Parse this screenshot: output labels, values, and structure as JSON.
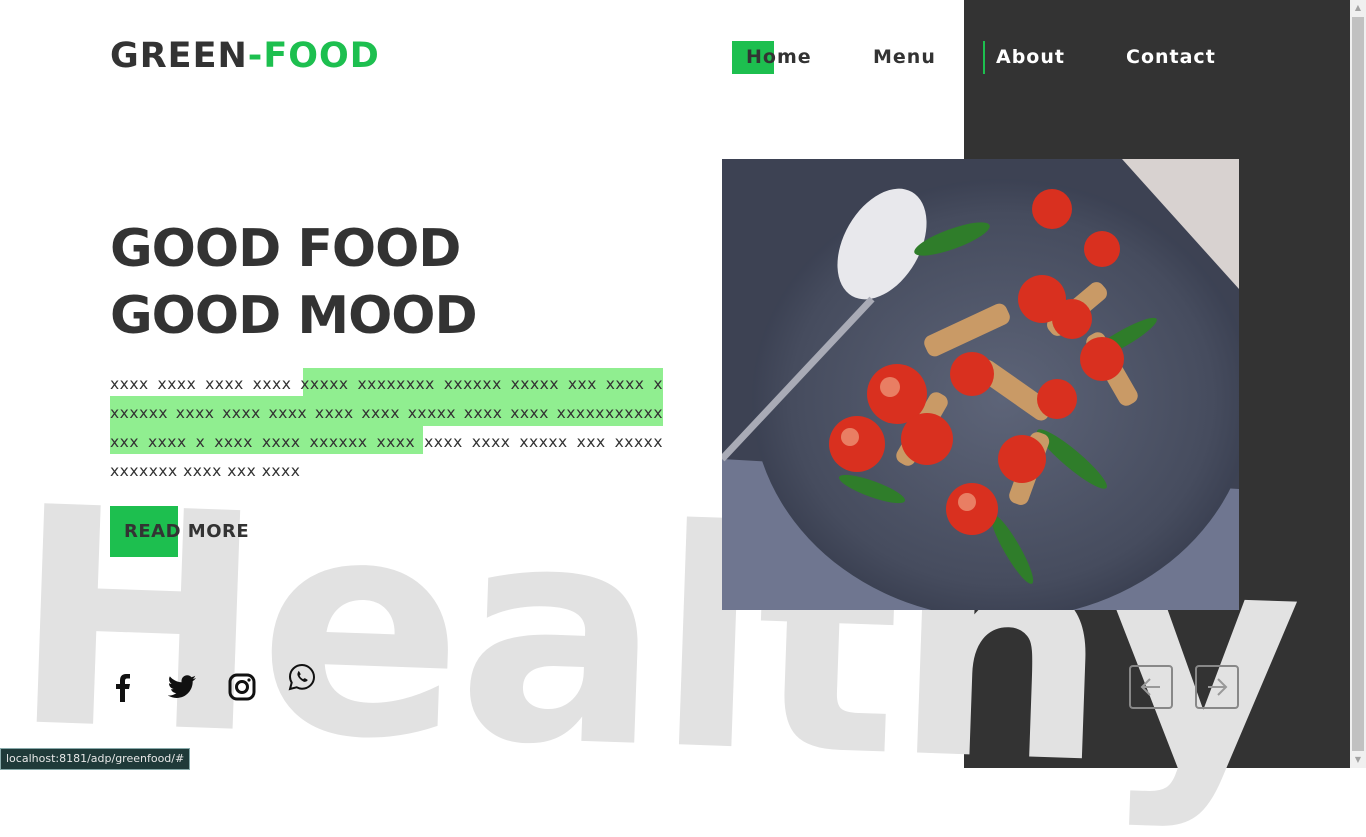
{
  "brand": {
    "part1": "GREEN",
    "part2": "-FOOD",
    "accent_color": "#1dbf4f"
  },
  "nav": {
    "home": "Home",
    "menu": "Menu",
    "about": "About",
    "contact": "Contact"
  },
  "hero": {
    "line1": "GOOD FOOD",
    "line2": "GOOD MOOD",
    "paragraph": "xxxx xxxx xxxx xxxx xxxxx xxxxxxxx xxxxxx xxxxx xxx xxxx x xxxxxx xxxx xxxx xxxx xxxx xxxx xxxxx xxxx xxxx xxxxxxxxxxx xxx xxxx x xxxx xxxx xxxxxx xxxx xxxx xxxx xxxxx xxx xxxxx xxxxxxx xxxx xxx xxxx",
    "read_more": "READ MORE",
    "watermark": "Healthy"
  },
  "social": {
    "icons": [
      "facebook-icon",
      "twitter-icon",
      "instagram-icon",
      "whatsapp-icon"
    ]
  },
  "slider": {
    "prev_icon": "arrow-left-icon",
    "next_icon": "arrow-right-icon"
  },
  "status_bar": {
    "url": "localhost:8181/adp/greenfood/#"
  },
  "colors": {
    "dark_panel": "#333333",
    "text": "#333333",
    "highlight": "#90ee90"
  }
}
